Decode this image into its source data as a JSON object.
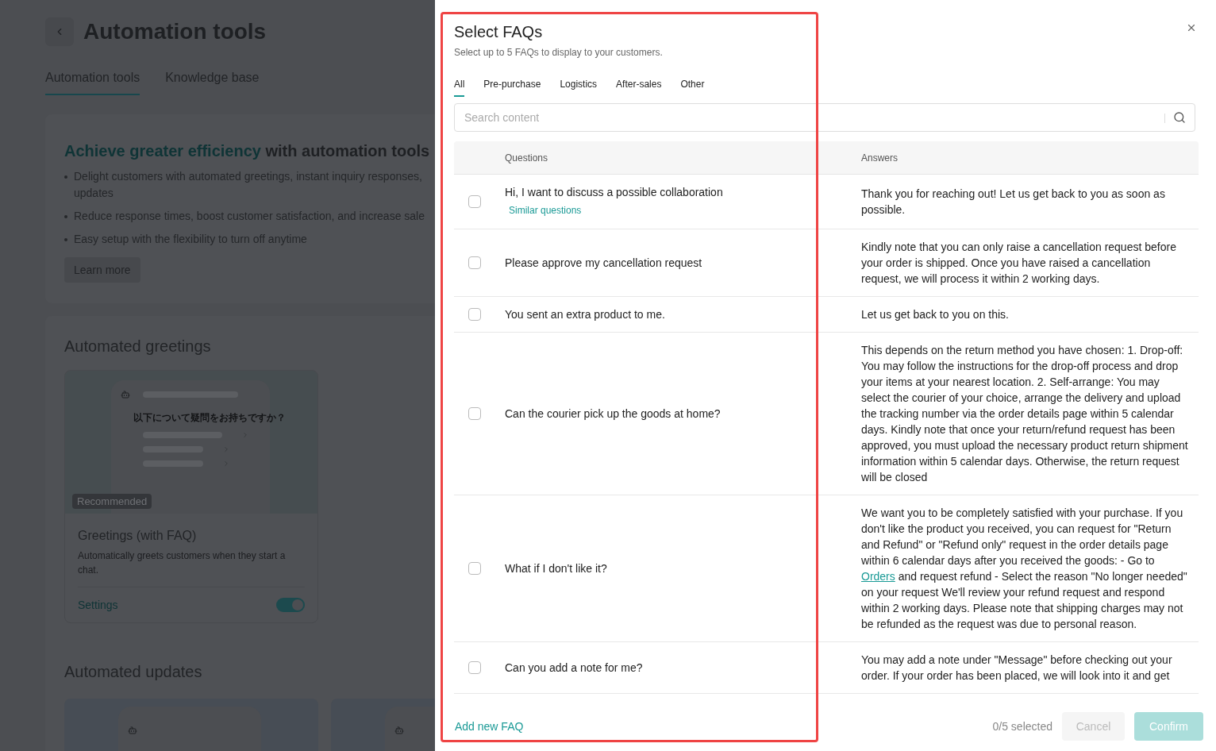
{
  "background_page": {
    "title": "Automation tools",
    "tabs": [
      {
        "label": "Automation tools",
        "selected": true
      },
      {
        "label": "Knowledge base",
        "selected": false
      }
    ],
    "promo": {
      "heading_highlight": "Achieve greater efficiency",
      "heading_rest": "with automation tools",
      "bullets": [
        "Delight customers with automated greetings, instant inquiry responses, updates",
        "Reduce response times, boost customer satisfaction, and increase sale",
        "Easy setup with the flexibility to turn off anytime"
      ],
      "button": "Learn more"
    },
    "greetings": {
      "heading": "Automated greetings",
      "card": {
        "preview_text": "以下について疑問をお持ちですか？",
        "badge": "Recommended",
        "title": "Greetings (with FAQ)",
        "description": "Automatically greets customers when they start a chat.",
        "link": "Settings",
        "on": true
      }
    },
    "updates": {
      "heading": "Automated updates"
    }
  },
  "drawer": {
    "title": "Select FAQs",
    "subtitle": "Select up to 5 FAQs to display to your customers.",
    "tabs": [
      {
        "label": "All",
        "selected": true
      },
      {
        "label": "Pre-purchase",
        "selected": false
      },
      {
        "label": "Logistics",
        "selected": false
      },
      {
        "label": "After-sales",
        "selected": false
      },
      {
        "label": "Other",
        "selected": false
      }
    ],
    "search": {
      "placeholder": "Search content"
    },
    "table": {
      "columns": [
        "Questions",
        "Answers"
      ],
      "rows": [
        {
          "checked": false,
          "question": "Hi, I want to discuss a possible collaboration",
          "similar_link": "Similar questions",
          "answer": [
            {
              "kind": "text",
              "text": "Thank you for reaching out! Let us get back to you as soon as possible."
            }
          ]
        },
        {
          "checked": false,
          "question": "Please approve my cancellation request",
          "answer": [
            {
              "kind": "text",
              "text": "Kindly note that you can only raise a cancellation request before your order is shipped. Once you have raised a cancellation request, we will process it within 2 working days."
            }
          ]
        },
        {
          "checked": false,
          "question": "You sent an extra product to me.",
          "answer": [
            {
              "kind": "text",
              "text": "Let us get back to you on this."
            }
          ]
        },
        {
          "checked": false,
          "question": "Can the courier pick up the goods at home?",
          "answer": [
            {
              "kind": "text",
              "text": "This depends on the return method you have chosen: 1. Drop-off: You may follow the instructions for the drop-off process and drop your items at your nearest location. 2. Self-arrange: You may select the courier of your choice, arrange the delivery and upload the tracking number via the order details page within 5 calendar days. Kindly note that once your return/refund request has been approved, you must upload the necessary product return shipment information within 5 calendar days. Otherwise, the return request will be closed"
            }
          ]
        },
        {
          "checked": false,
          "question": "What if I don't like it?",
          "answer": [
            {
              "kind": "text",
              "text": "We want you to be completely satisfied with your purchase. If you don't like the product you received, you can request for \"Return and Refund\" or \"Refund only\" request in the order details page within 6 calendar days after you received the goods: - Go to "
            },
            {
              "kind": "link",
              "text": "Orders"
            },
            {
              "kind": "text",
              "text": " and request refund - Select the reason \"No longer needed\" on your request We'll review your refund request and respond within 2 working days. Please note that shipping charges may not be refunded as the request was due to personal reason."
            }
          ]
        },
        {
          "checked": false,
          "question": "Can you add a note for me?",
          "answer": [
            {
              "kind": "text",
              "text": "You may add a note under \"Message\" before checking out your order. If your order has been placed, we will look into it and get"
            }
          ]
        }
      ]
    },
    "footer": {
      "add_link": "Add new FAQ",
      "count": "0/5 selected",
      "cancel": {
        "label": "Cancel",
        "disabled": true
      },
      "confirm": {
        "label": "Confirm",
        "disabled": true
      }
    }
  },
  "highlight": {
    "on": true
  }
}
